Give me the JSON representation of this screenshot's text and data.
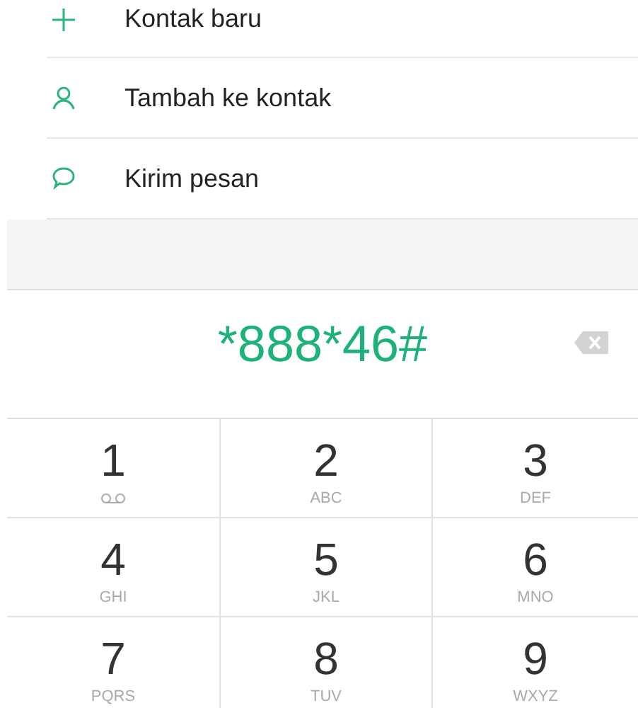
{
  "actions": [
    {
      "label": "Kontak baru",
      "kind": "plus"
    },
    {
      "label": "Tambah ke kontak",
      "kind": "person"
    },
    {
      "label": "Kirim pesan",
      "kind": "message"
    }
  ],
  "dialed": "*888*46#",
  "keys": [
    {
      "digit": "1",
      "kind": "voicemail"
    },
    {
      "digit": "2",
      "kind": "letters",
      "letters": "ABC"
    },
    {
      "digit": "3",
      "kind": "letters",
      "letters": "DEF"
    },
    {
      "digit": "4",
      "kind": "letters",
      "letters": "GHI"
    },
    {
      "digit": "5",
      "kind": "letters",
      "letters": "JKL"
    },
    {
      "digit": "6",
      "kind": "letters",
      "letters": "MNO"
    },
    {
      "digit": "7",
      "kind": "letters",
      "letters": "PQRS"
    },
    {
      "digit": "8",
      "kind": "letters",
      "letters": "TUV"
    },
    {
      "digit": "9",
      "kind": "letters",
      "letters": "WXYZ"
    }
  ]
}
